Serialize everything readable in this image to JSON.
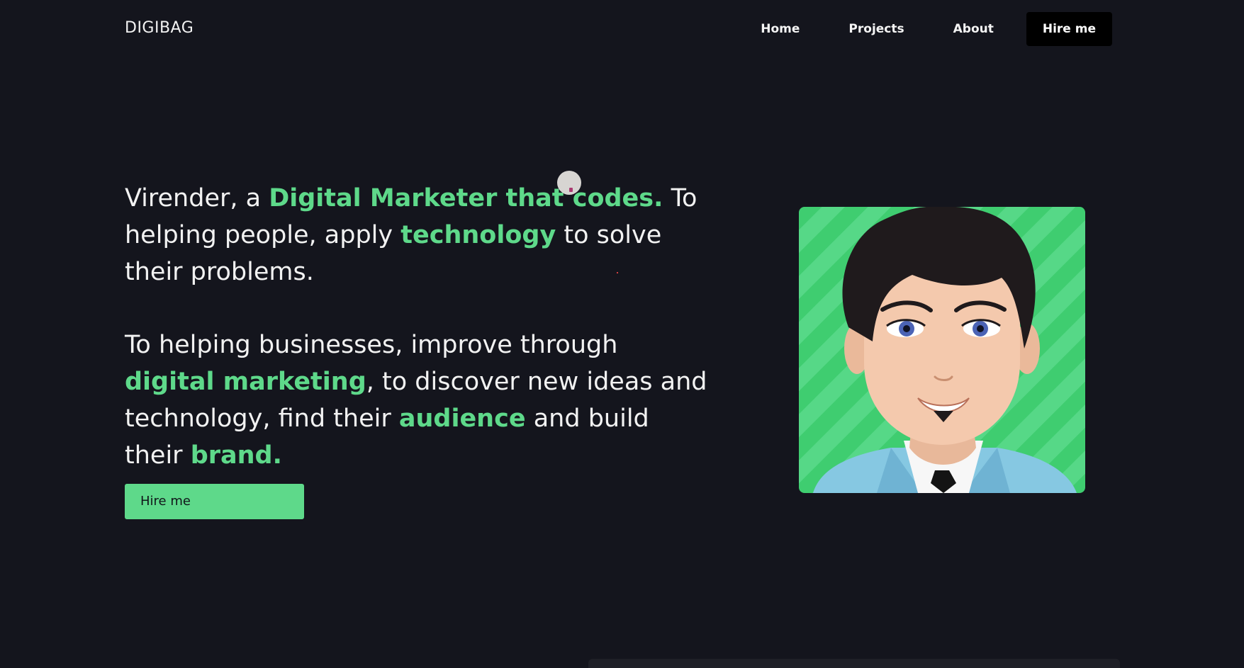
{
  "header": {
    "logo": "DIGIBAG",
    "nav": {
      "home": "Home",
      "projects": "Projects",
      "about": "About",
      "hire": "Hire me"
    }
  },
  "hero": {
    "p1": {
      "t1": "Virender, a ",
      "h1": "Digital Marketer that codes.",
      "t2": " To helping people, apply ",
      "h2": "technology",
      "t3": " to solve their problems."
    },
    "p2": {
      "t1": "To helping businesses, improve through ",
      "h1": "digital marketing",
      "t2": ", to discover new ideas and technology, find their ",
      "h2": "audience",
      "t3": " and build their ",
      "h3": "brand."
    },
    "cta_label": "Hire me"
  },
  "colors": {
    "background": "#14151d",
    "accent": "#5ed98a",
    "nav_button_bg": "#000000"
  },
  "icons": {
    "avatar": "cartoon-man-avatar"
  }
}
